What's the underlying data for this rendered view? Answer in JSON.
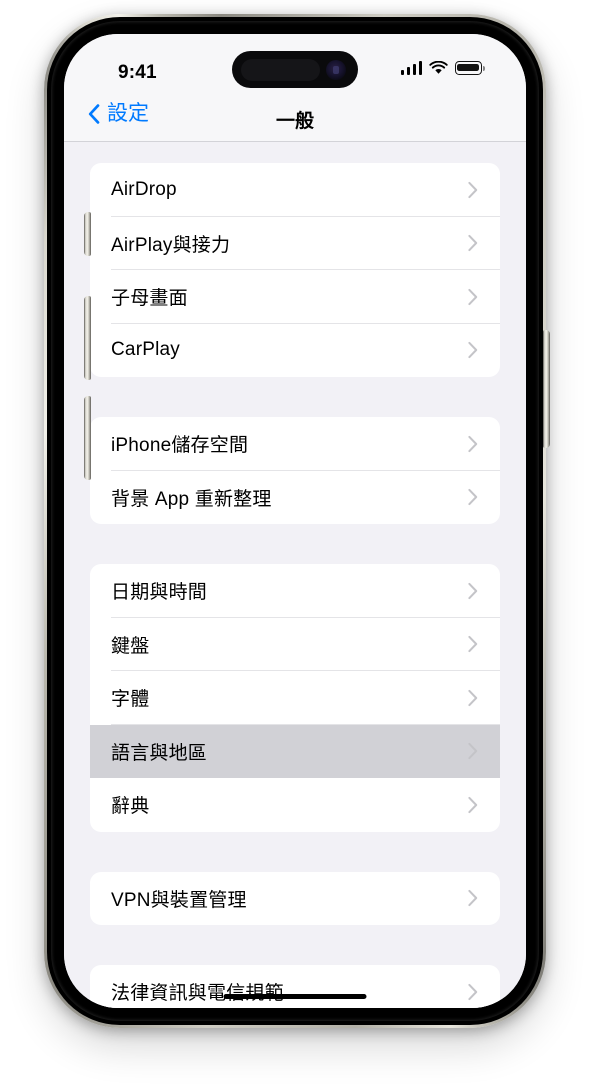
{
  "status_bar": {
    "time": "9:41",
    "cellular_icon": "cellular-signal-icon",
    "cellular_bars": 4,
    "wifi_icon": "wifi-icon",
    "battery_icon": "battery-full-icon"
  },
  "nav": {
    "back_label": "設定",
    "back_icon": "chevron-left-icon",
    "title": "一般"
  },
  "groups": [
    {
      "rows": [
        {
          "label": "AirDrop",
          "selected": false
        },
        {
          "label": "AirPlay與接力",
          "selected": false
        },
        {
          "label": "子母畫面",
          "selected": false
        },
        {
          "label": "CarPlay",
          "selected": false
        }
      ]
    },
    {
      "rows": [
        {
          "label": "iPhone儲存空間",
          "selected": false
        },
        {
          "label": "背景 App 重新整理",
          "selected": false
        }
      ]
    },
    {
      "rows": [
        {
          "label": "日期與時間",
          "selected": false
        },
        {
          "label": "鍵盤",
          "selected": false
        },
        {
          "label": "字體",
          "selected": false
        },
        {
          "label": "語言與地區",
          "selected": true
        },
        {
          "label": "辭典",
          "selected": false
        }
      ]
    },
    {
      "rows": [
        {
          "label": "VPN與裝置管理",
          "selected": false
        }
      ]
    },
    {
      "rows": [
        {
          "label": "法律資訊與電信規範",
          "selected": false
        }
      ]
    }
  ],
  "colors": {
    "accent_blue": "#007AFF",
    "grouped_background": "#F2F1F6",
    "card_background": "#FFFFFF",
    "selected_row": "#D1D1D6",
    "separator": "#E4E4E7",
    "chevron": "#C4C4C8"
  },
  "row_chevron_icon": "chevron-right-icon",
  "home_indicator": "home-indicator"
}
